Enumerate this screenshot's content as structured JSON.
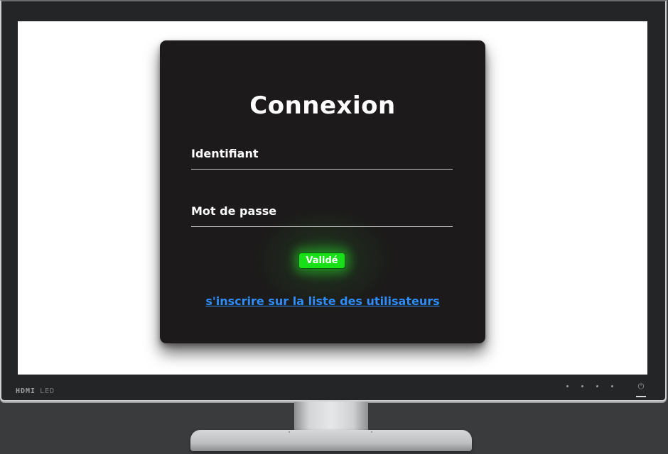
{
  "monitor": {
    "brand": "HDMI",
    "brand_suffix": "LED",
    "power_symbol": "⏻"
  },
  "login": {
    "title": "Connexion",
    "username_label": "Identifiant",
    "username_value": "",
    "password_label": "Mot de passe",
    "password_value": "",
    "submit_label": "Validé",
    "signup_link": "s'inscrire sur la liste des utilisateurs"
  },
  "colors": {
    "card_background": "#1c1a1a",
    "submit_green": "#17e017",
    "link_blue": "#2e8cff"
  }
}
